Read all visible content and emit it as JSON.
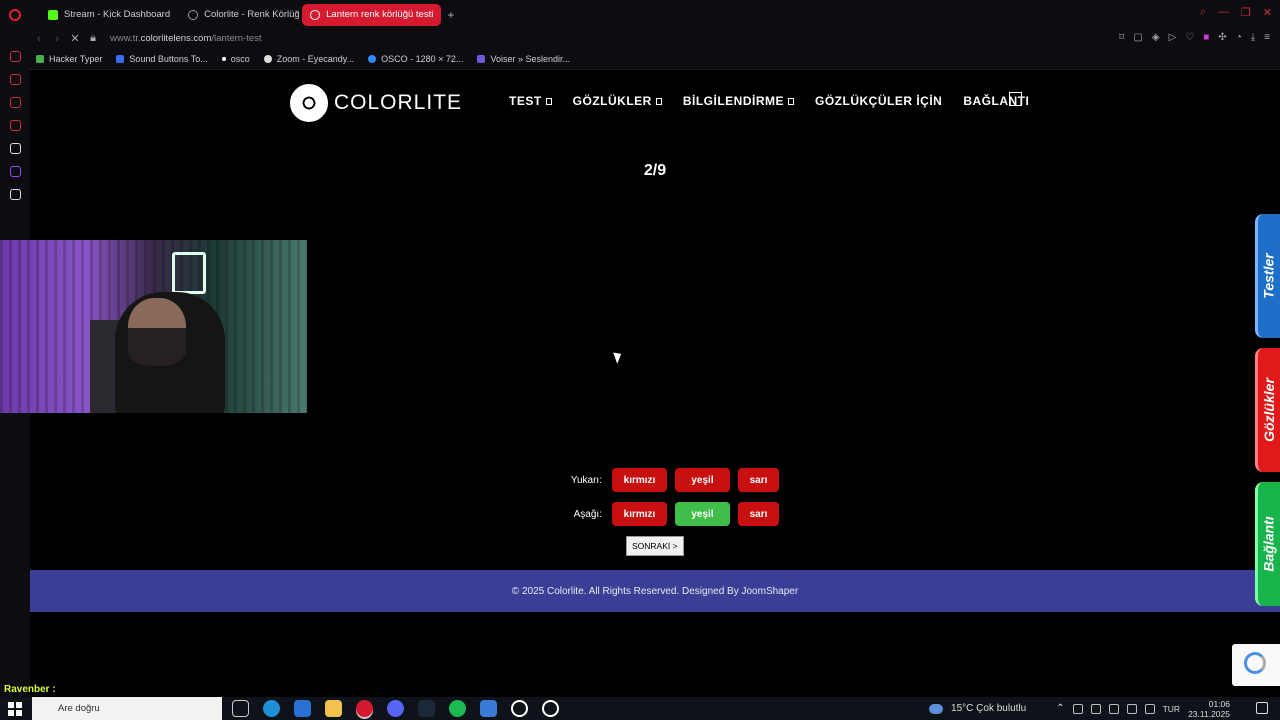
{
  "browser": {
    "tabs": [
      {
        "label": "Stream - Kick Dashboard",
        "color": "#53fc18"
      },
      {
        "label": "Colorlite - Renk Körlüğü T",
        "color": "#999999"
      },
      {
        "label": "Lantern renk körlüğü testi",
        "color": "#ffffff"
      }
    ],
    "url_prefix": "www.tr.",
    "url_domain": "colorlitelens.com",
    "url_path": "/lantern-test",
    "bookmarks": [
      {
        "label": "Hacker Typer",
        "color": "#4caf50"
      },
      {
        "label": "Sound Buttons To...",
        "color": "#3b6cf0"
      },
      {
        "label": "osco",
        "color": "#ffffff"
      },
      {
        "label": "Zoom - Eyecandy...",
        "color": "#dddddd"
      },
      {
        "label": "OSCO - 1280 × 72...",
        "color": "#2d8cff"
      },
      {
        "label": "Voiser » Seslendir...",
        "color": "#6b5bd6"
      }
    ]
  },
  "site": {
    "logo_text": "COLORLITE",
    "nav": [
      {
        "label": "TEST",
        "dropdown": true
      },
      {
        "label": "GÖZLÜKLER",
        "dropdown": true
      },
      {
        "label": "BİLGİLENDİRME",
        "dropdown": true
      },
      {
        "label": "GÖZLÜKÇÜLER İÇİN",
        "dropdown": false
      },
      {
        "label": "BAĞLANTI",
        "dropdown": false
      }
    ],
    "progress": "2/9",
    "question_rows": [
      {
        "label": "Yukarı:",
        "options": [
          "kırmızı",
          "yeşil",
          "sarı"
        ],
        "selected": null
      },
      {
        "label": "Aşağı:",
        "options": [
          "kırmızı",
          "yeşil",
          "sarı"
        ],
        "selected": "yeşil"
      }
    ],
    "next_button": "SONRAKİ >",
    "footer": "© 2025 Colorlite. All Rights Reserved. Designed By JoomShaper",
    "side_tabs": [
      {
        "label": "Testler",
        "color": "#1e6fc8"
      },
      {
        "label": "Gözlükler",
        "color": "#e01a1a"
      },
      {
        "label": "Bağlantı",
        "color": "#18b34b"
      }
    ],
    "selected_color": "#3fbf4a",
    "button_color": "#c81010",
    "footer_color": "#3b3e94"
  },
  "stream_overlay": {
    "viewer_name": "Ravenber :"
  },
  "taskbar": {
    "search_text": "Are doğru",
    "weather": "15°C  Çok bulutlu",
    "lang": "TUR",
    "time": "01:06",
    "date": "23.11.2025"
  }
}
